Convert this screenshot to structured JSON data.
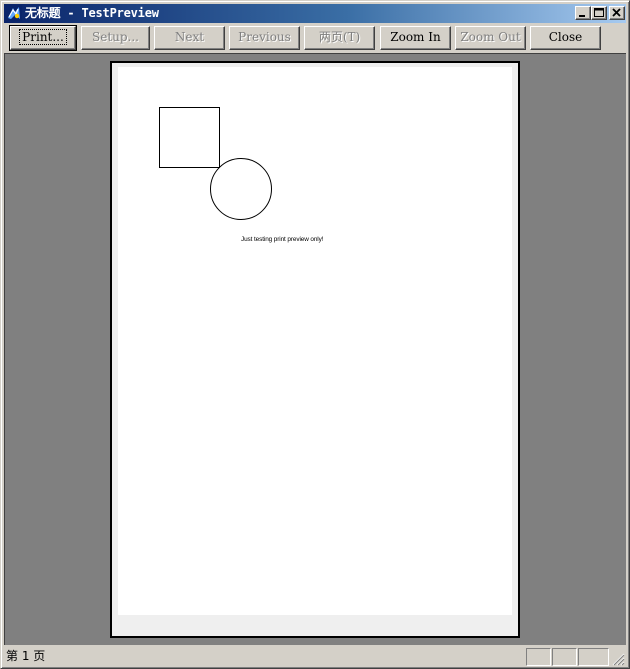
{
  "window": {
    "title": "无标题 - TestPreview"
  },
  "caption_buttons": {
    "minimize_icon": "minimize-icon",
    "maximize_icon": "maximize-icon",
    "close_icon": "close-icon"
  },
  "toolbar": {
    "print_label": "Print...",
    "setup_label": "Setup...",
    "next_label": "Next",
    "previous_label": "Previous",
    "two_page_label": "两页(T)",
    "zoom_in_label": "Zoom In",
    "zoom_out_label": "Zoom Out",
    "close_label": "Close"
  },
  "page": {
    "text": "Just testing print preview only!",
    "shapes": [
      "square",
      "circle"
    ]
  },
  "status": {
    "page_indicator": "第 1 页"
  }
}
